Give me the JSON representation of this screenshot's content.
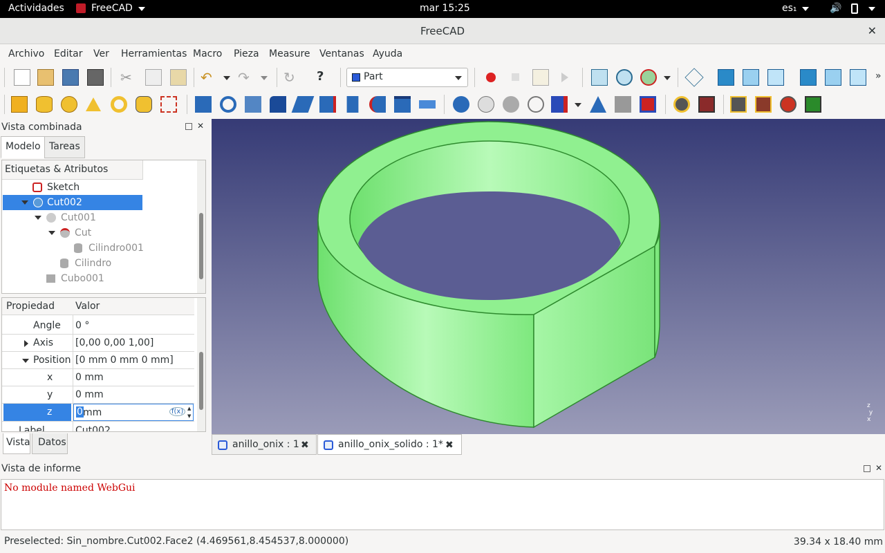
{
  "topbar": {
    "activities": "Actividades",
    "app": "FreeCAD",
    "clock": "mar 15:25",
    "keyboard": "es₁"
  },
  "window": {
    "title": "FreeCAD"
  },
  "menu": [
    "Archivo",
    "Editar",
    "Ver",
    "Herramientas",
    "Macro",
    "Pieza",
    "Measure",
    "Ventanas",
    "Ayuda"
  ],
  "workbench": "Part",
  "combo": {
    "title": "Vista combinada",
    "tabs": [
      "Modelo",
      "Tareas"
    ],
    "tree_header": "Etiquetas & Atributos"
  },
  "tree": [
    {
      "label": "Sketch",
      "dim": false
    },
    {
      "label": "Cut002",
      "dim": false,
      "selected": true
    },
    {
      "label": "Cut001",
      "dim": true
    },
    {
      "label": "Cut",
      "dim": true
    },
    {
      "label": "Cilindro001",
      "dim": true
    },
    {
      "label": "Cilindro",
      "dim": true
    },
    {
      "label": "Cubo001",
      "dim": true
    }
  ],
  "props": {
    "header_prop": "Propiedad",
    "header_val": "Valor",
    "rows": [
      {
        "k": "Angle",
        "v": "0 °"
      },
      {
        "k": "Axis",
        "v": "[0,00 0,00 1,00]"
      },
      {
        "k": "Position",
        "v": "[0 mm  0 mm  0 mm]"
      },
      {
        "k": "x",
        "v": "0 mm"
      },
      {
        "k": "y",
        "v": "0 mm"
      },
      {
        "k": "z",
        "v": "0",
        "v2": "mm"
      },
      {
        "k": "Label",
        "v": "Cut002"
      }
    ],
    "bottom_tabs": [
      "Vista",
      "Datos"
    ],
    "fx": "f(x)"
  },
  "doc_tabs": [
    "anillo_onix : 1",
    "anillo_onix_solido : 1*"
  ],
  "report": {
    "title": "Vista de informe",
    "message": "No module named WebGui"
  },
  "status": {
    "left": "Preselected: Sin_nombre.Cut002.Face2 (4.469561,8.454537,8.000000)",
    "right": "39.34 x 18.40 mm"
  },
  "colors": {
    "selection": "#3584e4",
    "solid": "#8ef08e",
    "error": "#cc0000"
  }
}
